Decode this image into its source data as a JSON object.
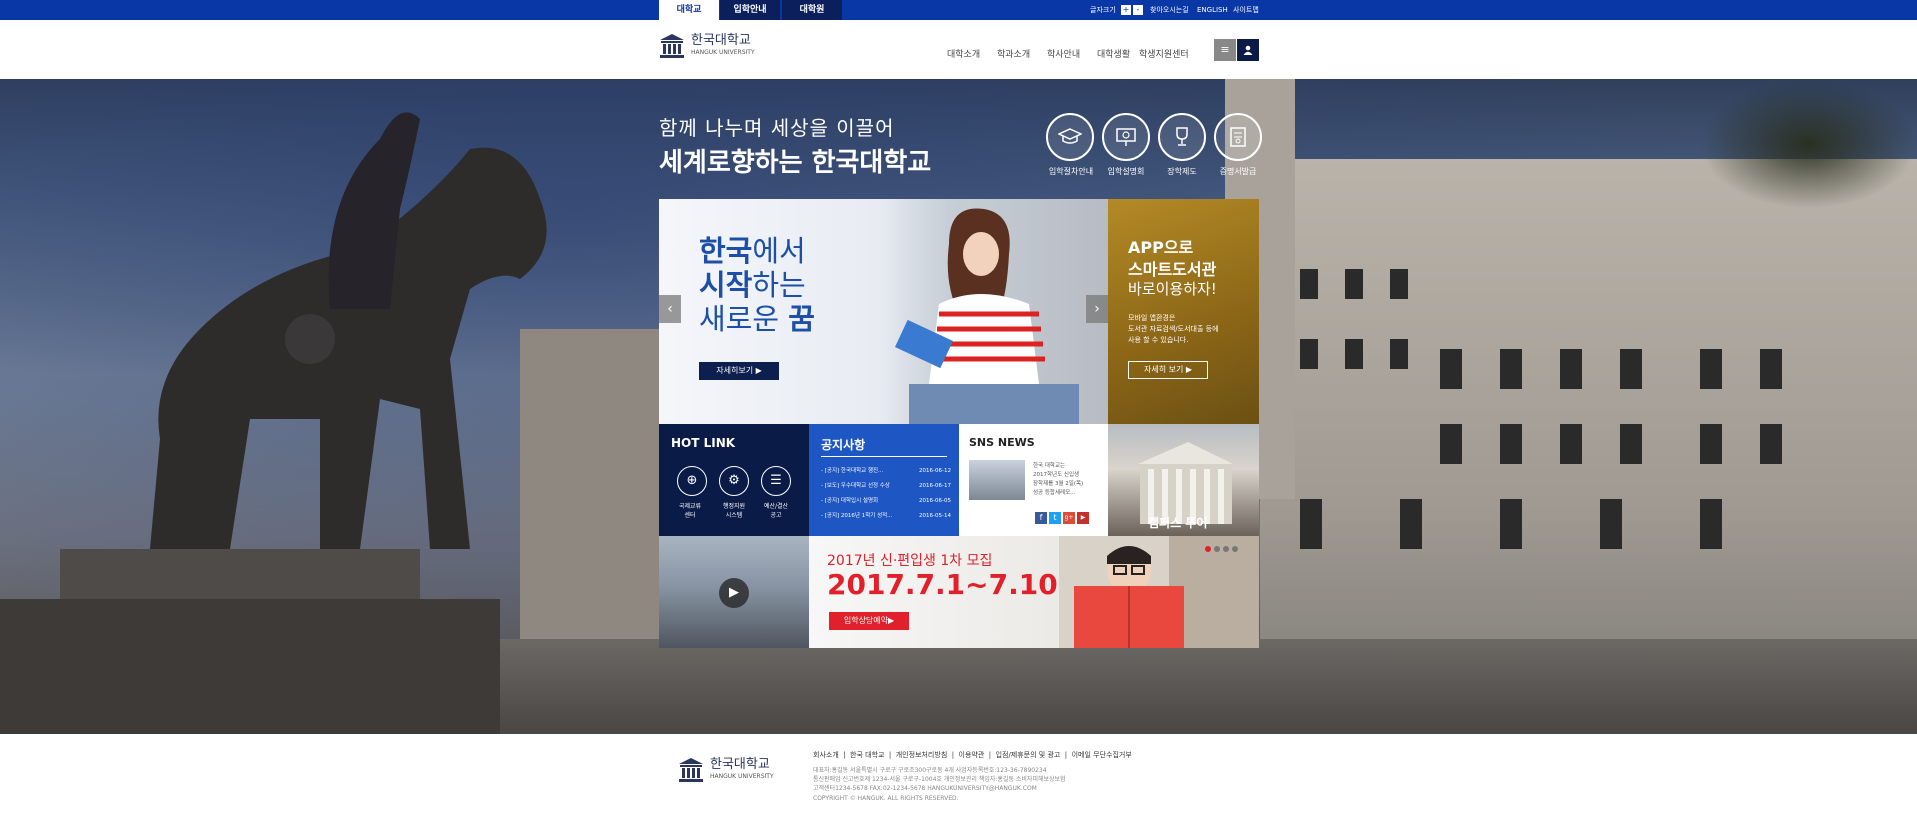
{
  "topbar": {
    "tabs": [
      "대학교",
      "입학안내",
      "대학원"
    ],
    "font_size_label": "글자크기",
    "font_plus": "+",
    "font_minus": "-",
    "links": [
      "찾아오시는길",
      "ENGLISH",
      "사이트맵"
    ]
  },
  "logo": {
    "ko": "한국대학교",
    "en": "HANGUK UNIVERSITY"
  },
  "gnb": [
    "대학소개",
    "학과소개",
    "학사안내",
    "대학생활",
    "학생지원센터"
  ],
  "header_buttons": {
    "menu_icon": "menu-icon",
    "user_icon": "user-icon"
  },
  "hero": {
    "tagline_small": "함께 나누며 세상을 이끌어",
    "tagline_big": "세계로향하는 한국대학교"
  },
  "quick_menu": [
    "입학절차안내",
    "입학설명회",
    "장학제도",
    "증명서발급"
  ],
  "slide": {
    "line1_bold": "한국",
    "line1_rest": "에서",
    "line2_bold": "시작",
    "line2_rest": "하는",
    "line3_rest": "새로운 ",
    "line3_bold": "꿈",
    "button": "자세히보기 ▶",
    "prev": "‹",
    "next": "›"
  },
  "app_promo": {
    "line1": "APP으로",
    "line2": "스마트도서관",
    "line3": "바로이용하자!",
    "desc1": "모바일 앱환경은",
    "desc2": "도서관 자료검색/도서대출 등에",
    "desc3": "사용 할 수 있습니다.",
    "button": "자세히 보기 ▶"
  },
  "hot_link": {
    "title": "HOT LINK",
    "items": [
      {
        "line1": "국제교류",
        "line2": "센터"
      },
      {
        "line1": "행정지원",
        "line2": "시스템"
      },
      {
        "line1": "예산/결산",
        "line2": "공고"
      }
    ]
  },
  "notice": {
    "title": "공지사항",
    "items": [
      {
        "title": "- [공지] 한국대학교 행진...",
        "date": "2016-06-12"
      },
      {
        "title": "- [보도] 우수대학교 선정 수상",
        "date": "2016-06-17"
      },
      {
        "title": "- [공지] 대학입시 설명회",
        "date": "2016-06-05"
      },
      {
        "title": "- [공지] 2016년 1학기 성적...",
        "date": "2016-05-14"
      }
    ]
  },
  "sns": {
    "title": "SNS NEWS",
    "text1": "한국 대학교는",
    "text2": "2017학년도 신입생",
    "text3": "장학제를 3월 2일(목)",
    "text4": "성공 등합세레모...",
    "social": [
      "f",
      "t",
      "g+",
      "▶"
    ]
  },
  "campus": {
    "label": "캠퍼스 투어"
  },
  "banner": {
    "sub": "2017년 신·편입생 1차 모집",
    "date": "2017.7.1~7.10",
    "button": "입학상담예약▶"
  },
  "footer": {
    "logo_ko": "한국대학교",
    "logo_en": "HANGUK UNIVERSITY",
    "links": [
      "회사소개",
      "한국 대학교",
      "개인정보처리방침",
      "이용약관",
      "입점/제휴문의 및 광고",
      "이메일 무단수집거부"
    ],
    "info1": "대표자:홍길동   서울특별시 구로구 구로조300구로동 4개    사업자등록번호:123-36-7890234",
    "info2": "통신판매업 신고번호제 1234-서울 구로구-1004호   개인정보관리 책임자:홍길동   소비자피해보상보험",
    "info3": "고객센터1234-5678  FAX:02-1234-5678  HANGUKUNIVERSITY@HANGUK.COM",
    "copyright": "COPYRIGHT © HANGUK. ALL RIGHTS RESERVED."
  },
  "colors": {
    "primary": "#0a37a6",
    "navy": "#0b1b48",
    "blue": "#1e56c4",
    "gold": "#a07a1e",
    "red": "#e0202a"
  }
}
